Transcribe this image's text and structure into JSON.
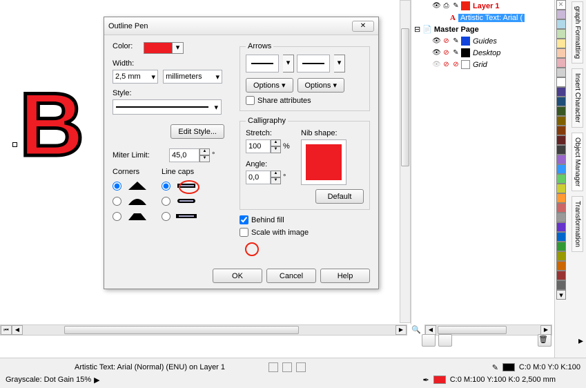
{
  "dialog": {
    "title": "Outline Pen",
    "color_label": "Color:",
    "width_label": "Width:",
    "width_value": "2,5 mm",
    "width_units": "millimeters",
    "style_label": "Style:",
    "edit_style_btn": "Edit Style...",
    "miter_label": "Miter Limit:",
    "miter_value": "45,0",
    "miter_deg": "°",
    "corners_label": "Corners",
    "linecaps_label": "Line caps",
    "arrows_legend": "Arrows",
    "options_btn": "Options",
    "share_attr": "Share attributes",
    "calligraphy_legend": "Calligraphy",
    "stretch_label": "Stretch:",
    "stretch_value": "100",
    "stretch_pct": "%",
    "angle_label": "Angle:",
    "angle_value": "0,0",
    "nib_label": "Nib shape:",
    "default_btn": "Default",
    "behind_fill": "Behind fill",
    "scale_img": "Scale with image",
    "ok_btn": "OK",
    "cancel_btn": "Cancel",
    "help_btn": "Help"
  },
  "layers": {
    "layer1": "Layer 1",
    "artistic_text": "Artistic Text: Arial (",
    "master_page": "Master Page",
    "guides": "Guides",
    "desktop": "Desktop",
    "grid": "Grid"
  },
  "tabs": {
    "graph": "graph Formatting",
    "insert": "Insert Character",
    "objmgr": "Object Manager",
    "transform": "Transformation"
  },
  "status": {
    "text_info": "Artistic Text: Arial (Normal) (ENU) on Layer 1",
    "grayscale": "Grayscale: Dot Gain 15%",
    "fill_info": "C:0 M:0 Y:0 K:100",
    "outline_info": "C:0 M:100 Y:100 K:0  2,500 mm"
  },
  "canvas": {
    "letter": "B"
  }
}
